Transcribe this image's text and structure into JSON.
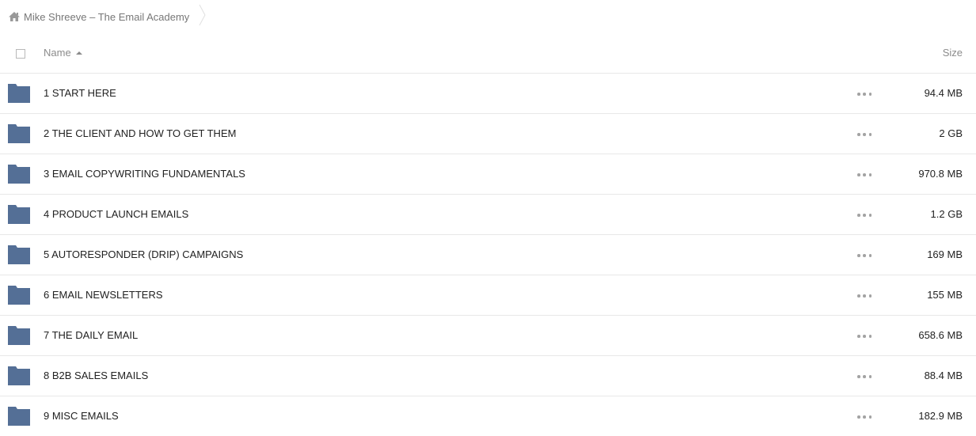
{
  "breadcrumb": {
    "title": "Mike Shreeve – The Email Academy",
    "icon": "home-icon"
  },
  "table": {
    "columns": {
      "name": "Name",
      "size": "Size",
      "sort": "ascending"
    },
    "rows": [
      {
        "name": "1 START HERE",
        "size": "94.4 MB"
      },
      {
        "name": "2 THE CLIENT AND HOW TO GET THEM",
        "size": "2 GB"
      },
      {
        "name": "3 EMAIL COPYWRITING FUNDAMENTALS",
        "size": "970.8 MB"
      },
      {
        "name": "4 PRODUCT LAUNCH EMAILS",
        "size": "1.2 GB"
      },
      {
        "name": "5 AUTORESPONDER (DRIP) CAMPAIGNS",
        "size": "169 MB"
      },
      {
        "name": "6 EMAIL NEWSLETTERS",
        "size": "155 MB"
      },
      {
        "name": "7 THE DAILY EMAIL",
        "size": "658.6 MB"
      },
      {
        "name": "8 B2B SALES EMAILS",
        "size": "88.4 MB"
      },
      {
        "name": "9 MISC EMAILS",
        "size": "182.9 MB"
      }
    ]
  },
  "colors": {
    "folder": "#546f96",
    "muted_text": "#8b8b8b",
    "divider": "#e8e8e8"
  }
}
